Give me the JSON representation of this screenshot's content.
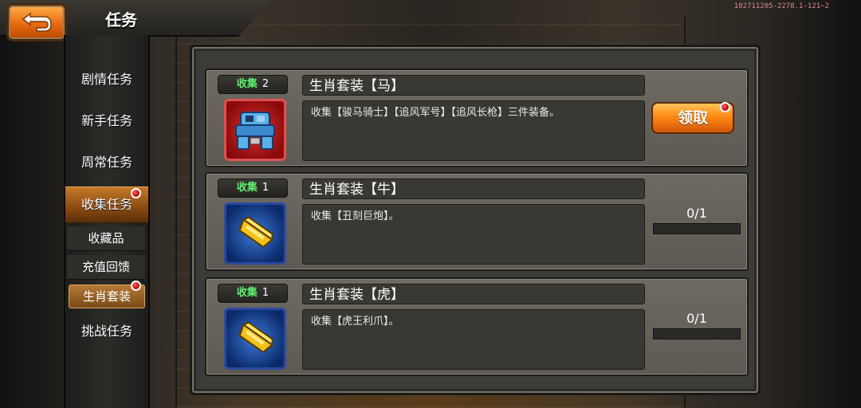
{
  "header": {
    "title": "任务",
    "version": "102711205-2278.1-121~2"
  },
  "sidebar": {
    "items": [
      {
        "label": "剧情任务"
      },
      {
        "label": "新手任务"
      },
      {
        "label": "周常任务"
      },
      {
        "label": "收集任务"
      },
      {
        "label": "收藏品"
      },
      {
        "label": "充值回馈"
      },
      {
        "label": "生肖套装"
      },
      {
        "label": "挑战任务"
      }
    ]
  },
  "tasks": [
    {
      "badge_label": "收集",
      "badge_count": "2",
      "title": "生肖套装【马】",
      "description": "收集【骏马骑士】【追风军号】【追风长枪】三件装备。",
      "action_label": "领取",
      "icon": "mech-robot-icon"
    },
    {
      "badge_label": "收集",
      "badge_count": "1",
      "title": "生肖套装【牛】",
      "description": "收集【丑刻巨炮】。",
      "progress_text": "0/1",
      "progress": 0,
      "icon": "gold-bar-icon"
    },
    {
      "badge_label": "收集",
      "badge_count": "1",
      "title": "生肖套装【虎】",
      "description": "收集【虎王利爪】。",
      "progress_text": "0/1",
      "progress": 0,
      "icon": "gold-bar-icon"
    }
  ],
  "colors": {
    "accent_orange": "#ff8a14",
    "badge_green": "#5ef070",
    "notification_red": "#d00000"
  }
}
